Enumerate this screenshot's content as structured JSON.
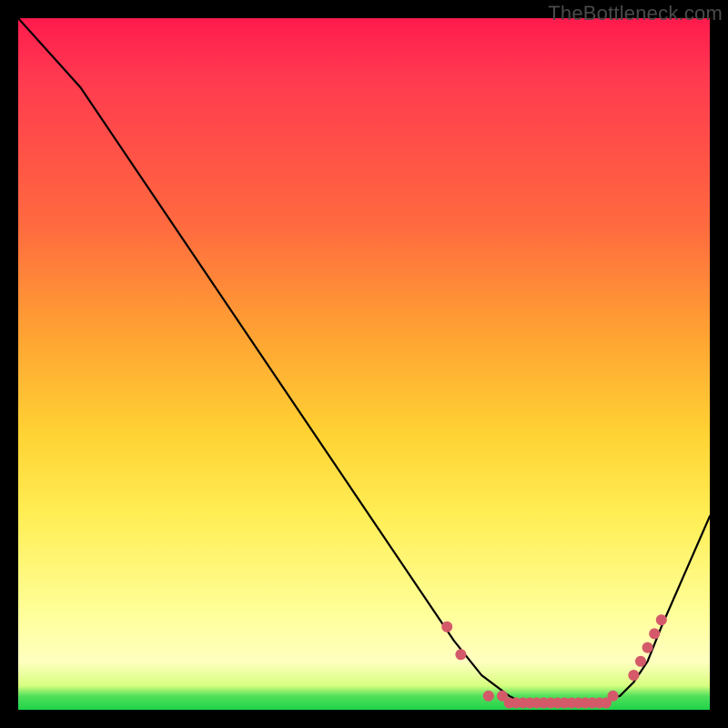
{
  "watermark": "TheBottleneck.com",
  "chart_data": {
    "type": "line",
    "title": "",
    "xlabel": "",
    "ylabel": "",
    "xlim": [
      0,
      100
    ],
    "ylim": [
      0,
      100
    ],
    "grid": false,
    "legend": false,
    "annotations": [],
    "series": [
      {
        "name": "curve",
        "color": "#000000",
        "x": [
          0,
          9,
          63,
          67,
          71,
          73,
          76,
          79,
          83,
          87,
          89,
          91,
          93,
          100
        ],
        "values": [
          100,
          90,
          10,
          5,
          2,
          1,
          1,
          1,
          1,
          2,
          4,
          7,
          12,
          28
        ]
      }
    ],
    "markers": {
      "name": "dots",
      "color": "#d45a6a",
      "radius": 6,
      "points": [
        {
          "x": 62,
          "y": 12
        },
        {
          "x": 64,
          "y": 8
        },
        {
          "x": 68,
          "y": 2
        },
        {
          "x": 70,
          "y": 2
        },
        {
          "x": 71,
          "y": 1
        },
        {
          "x": 72,
          "y": 1
        },
        {
          "x": 73,
          "y": 1
        },
        {
          "x": 74,
          "y": 1
        },
        {
          "x": 75,
          "y": 1
        },
        {
          "x": 76,
          "y": 1
        },
        {
          "x": 77,
          "y": 1
        },
        {
          "x": 78,
          "y": 1
        },
        {
          "x": 79,
          "y": 1
        },
        {
          "x": 80,
          "y": 1
        },
        {
          "x": 81,
          "y": 1
        },
        {
          "x": 82,
          "y": 1
        },
        {
          "x": 83,
          "y": 1
        },
        {
          "x": 84,
          "y": 1
        },
        {
          "x": 85,
          "y": 1
        },
        {
          "x": 86,
          "y": 2
        },
        {
          "x": 89,
          "y": 5
        },
        {
          "x": 90,
          "y": 7
        },
        {
          "x": 91,
          "y": 9
        },
        {
          "x": 92,
          "y": 11
        },
        {
          "x": 93,
          "y": 13
        }
      ]
    }
  }
}
